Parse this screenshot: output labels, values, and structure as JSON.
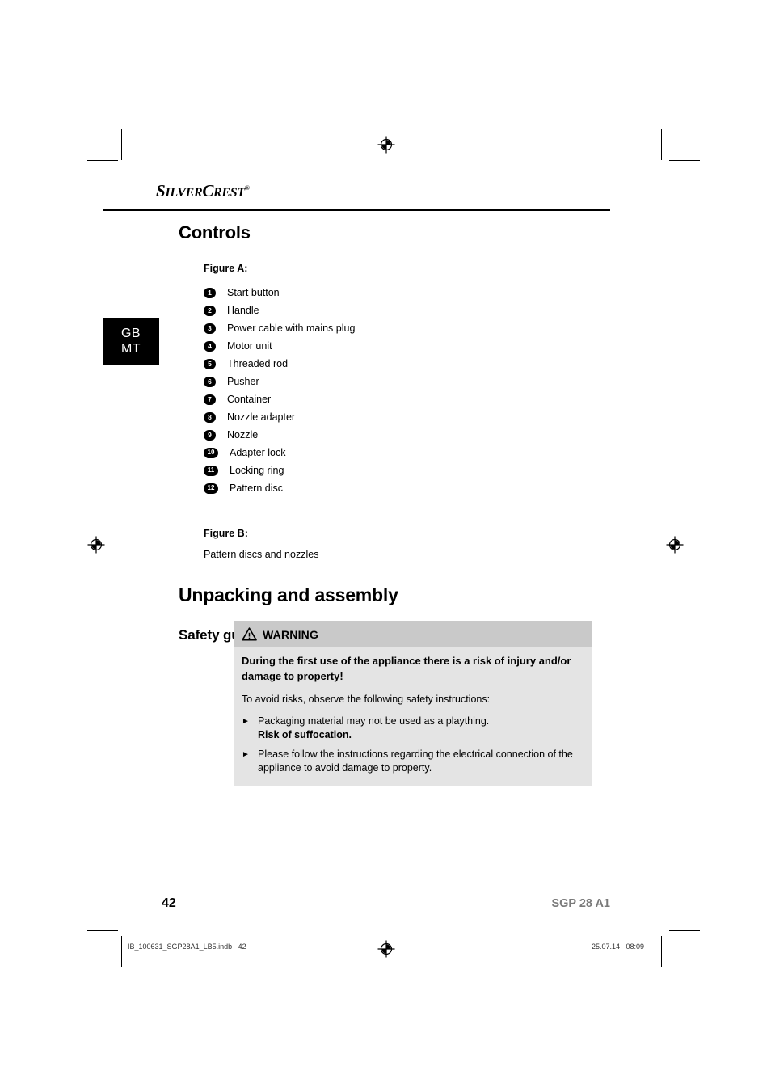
{
  "document": {
    "brand": {
      "name_part1": "S",
      "name_part2": "ILVER",
      "name_part3": "C",
      "name_part4": "REST",
      "registered_mark": "®"
    },
    "language_tab": {
      "line1": "GB",
      "line2": "MT"
    },
    "sections": {
      "controls_title": "Controls",
      "figure_a_label": "Figure A:",
      "figure_b_label": "Figure B:",
      "figure_b_caption": "Pattern discs and nozzles",
      "unpacking_title": "Unpacking and assembly",
      "safety_title": "Safety guidelines"
    },
    "parts_list": [
      {
        "number": "1",
        "label": "Start button"
      },
      {
        "number": "2",
        "label": "Handle"
      },
      {
        "number": "3",
        "label": "Power cable with mains plug"
      },
      {
        "number": "4",
        "label": "Motor unit"
      },
      {
        "number": "5",
        "label": "Threaded rod"
      },
      {
        "number": "6",
        "label": "Pusher"
      },
      {
        "number": "7",
        "label": "Container"
      },
      {
        "number": "8",
        "label": "Nozzle adapter"
      },
      {
        "number": "9",
        "label": "Nozzle"
      },
      {
        "number": "10",
        "label": "Adapter lock"
      },
      {
        "number": "11",
        "label": "Locking ring"
      },
      {
        "number": "12",
        "label": "Pattern disc"
      }
    ],
    "warning": {
      "icon_name": "warning-triangle-icon",
      "heading": "WARNING",
      "lead": "During the first use of the appliance there is a risk of injury and/or damage to property!",
      "intro": "To avoid risks, observe the following safety instructions:",
      "bullet_glyph": "►",
      "items": [
        {
          "text": "Packaging material may not be used as a plaything.",
          "bold_text": "Risk of suffocation."
        },
        {
          "text": "Please follow the instructions regarding the electrical connection of the appliance to avoid damage to property.",
          "bold_text": ""
        }
      ],
      "header_color": "#c9c9c9",
      "body_color": "#e4e4e4"
    },
    "footer": {
      "page_number": "42",
      "model": "SGP 28 A1",
      "print_file": "IB_100631_SGP28A1_LB5.indb   42",
      "print_timestamp": "25.07.14   08:09"
    }
  }
}
